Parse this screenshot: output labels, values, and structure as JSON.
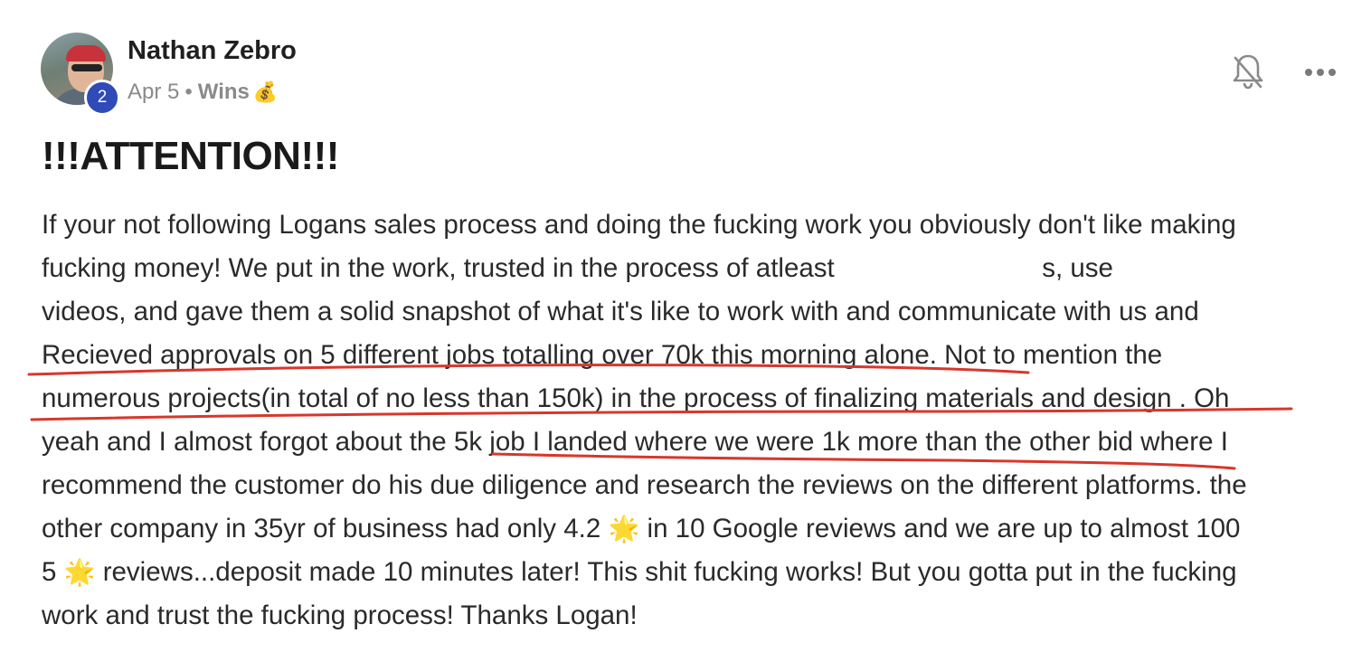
{
  "post": {
    "author": "Nathan Zebro",
    "level": "2",
    "date": "Apr 5",
    "separator": "•",
    "category": "Wins",
    "category_emoji": "💰",
    "title": "!!!ATTENTION!!!",
    "lines": [
      "If your not following Logans sales process and doing the fucking work you obviously don't like making",
      "fucking money! We put in the work, trusted in the process of atleast",
      "videos, and gave them a solid snapshot of what it's like to work with and communicate with us and",
      "Recieved approvals on 5 different jobs totalling over 70k this morning alone. Not to mention the",
      "numerous projects(in total of no less than 150k) in the process of finalizing materials and design . Oh",
      "yeah and I almost forgot about the 5k job I landed where we were 1k more than the other bid where I",
      "recommend the customer do his due diligence and research the reviews on the different platforms. the",
      "in 10 Google reviews and we are up to almost 100",
      "reviews...deposit made 10 minutes later! This shit fucking works! But you gotta put in the fucking",
      "work and trust the fucking process! Thanks Logan!"
    ],
    "line2_after_redaction": "s, use",
    "line8_start": "other company in 35yr of business had only 4.2",
    "line9_start": "5",
    "star_emoji": "🌟"
  },
  "icons": {
    "bell": "bell-slash-icon",
    "more": "more-horizontal-icon"
  },
  "colors": {
    "level_badge": "#2f4bb8",
    "underline": "#d8372c",
    "meta_text": "#8a8a8a"
  }
}
